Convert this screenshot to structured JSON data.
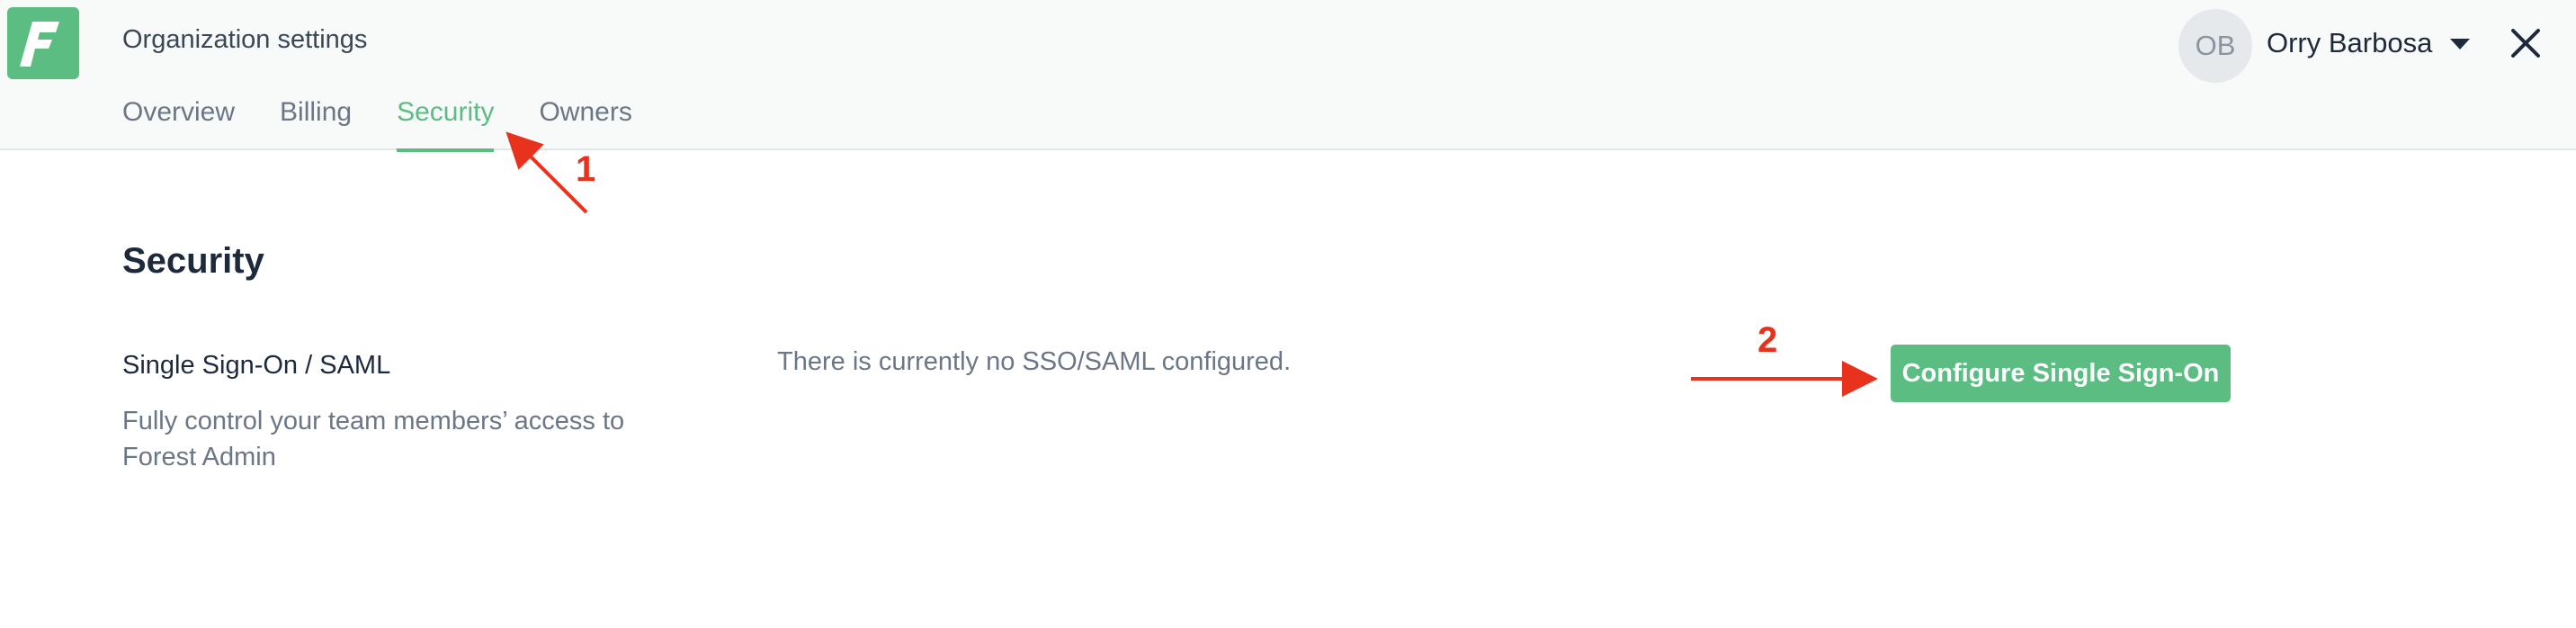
{
  "header": {
    "logo_letter": "F",
    "org_title": "Organization settings",
    "tabs": [
      {
        "label": "Overview"
      },
      {
        "label": "Billing"
      },
      {
        "label": "Security"
      },
      {
        "label": "Owners"
      }
    ],
    "active_tab": "Security",
    "user": {
      "initials": "OB",
      "name": "Orry Barbosa"
    }
  },
  "main": {
    "section_title": "Security",
    "sso": {
      "label": "Single Sign-On / SAML",
      "description": "Fully control your team members’ access to Forest Admin",
      "status": "There is currently no SSO/SAML configured.",
      "button_label": "Configure Single Sign-On"
    }
  },
  "annotations": [
    {
      "number": "1"
    },
    {
      "number": "2"
    }
  ],
  "colors": {
    "accent": "#5bbd82",
    "annotation": "#e8321e",
    "header_bg": "#f8faf9",
    "text_primary": "#1e2a3b",
    "text_muted": "#6b7686"
  },
  "icons": [
    "forest-logo-icon",
    "chevron-down-icon",
    "close-icon",
    "annotation-arrow-icon"
  ]
}
